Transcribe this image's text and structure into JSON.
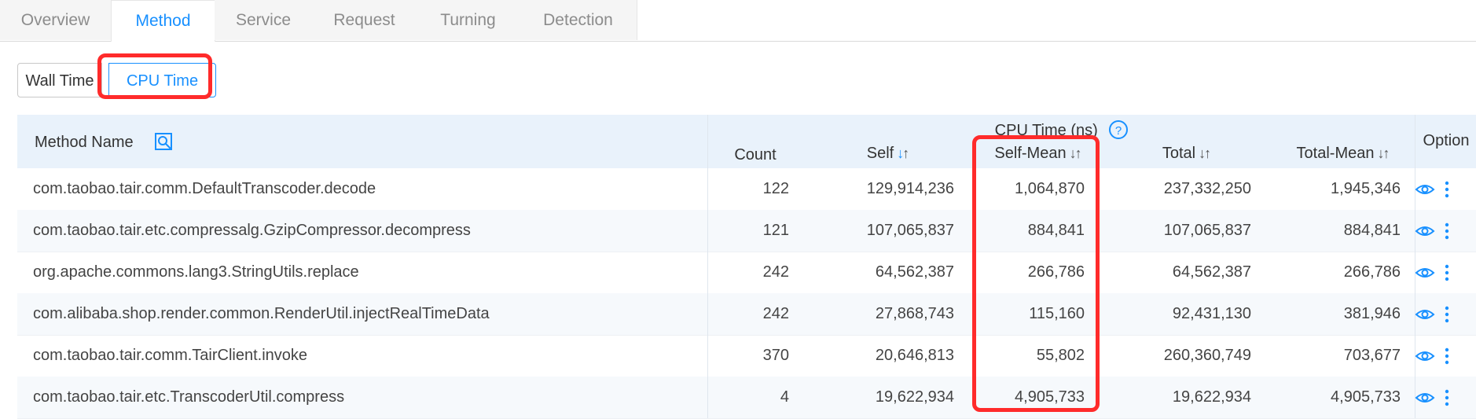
{
  "tabs": [
    "Overview",
    "Method",
    "Service",
    "Request",
    "Turning",
    "Detection"
  ],
  "active_tab": "Method",
  "toggle": {
    "wall_time": "Wall Time",
    "cpu_time": "CPU Time",
    "selected": "CPU Time"
  },
  "table": {
    "method_header": "Method Name",
    "group_header": "CPU Time (ns)",
    "option_header": "Option",
    "columns": [
      "Count",
      "Self",
      "Self-Mean",
      "Total",
      "Total-Mean"
    ],
    "rows": [
      {
        "method": "com.taobao.tair.comm.DefaultTranscoder.decode",
        "count": "122",
        "self": "129,914,236",
        "self_mean": "1,064,870",
        "total": "237,332,250",
        "total_mean": "1,945,346"
      },
      {
        "method": "com.taobao.tair.etc.compressalg.GzipCompressor.decompress",
        "count": "121",
        "self": "107,065,837",
        "self_mean": "884,841",
        "total": "107,065,837",
        "total_mean": "884,841"
      },
      {
        "method": "org.apache.commons.lang3.StringUtils.replace",
        "count": "242",
        "self": "64,562,387",
        "self_mean": "266,786",
        "total": "64,562,387",
        "total_mean": "266,786"
      },
      {
        "method": "com.alibaba.shop.render.common.RenderUtil.injectRealTimeData",
        "count": "242",
        "self": "27,868,743",
        "self_mean": "115,160",
        "total": "92,431,130",
        "total_mean": "381,946"
      },
      {
        "method": "com.taobao.tair.comm.TairClient.invoke",
        "count": "370",
        "self": "20,646,813",
        "self_mean": "55,802",
        "total": "260,360,749",
        "total_mean": "703,677"
      },
      {
        "method": "com.taobao.tair.etc.TranscoderUtil.compress",
        "count": "4",
        "self": "19,622,934",
        "self_mean": "4,905,733",
        "total": "19,622,934",
        "total_mean": "4,905,733"
      }
    ]
  },
  "icons": {
    "search": "search-icon",
    "help": "question-circle-icon",
    "view": "eye-icon",
    "more": "more-vertical-icon"
  },
  "colors": {
    "accent": "#1890ff",
    "highlight": "#ff2b2b",
    "header_bg": "#e9f2fb"
  }
}
